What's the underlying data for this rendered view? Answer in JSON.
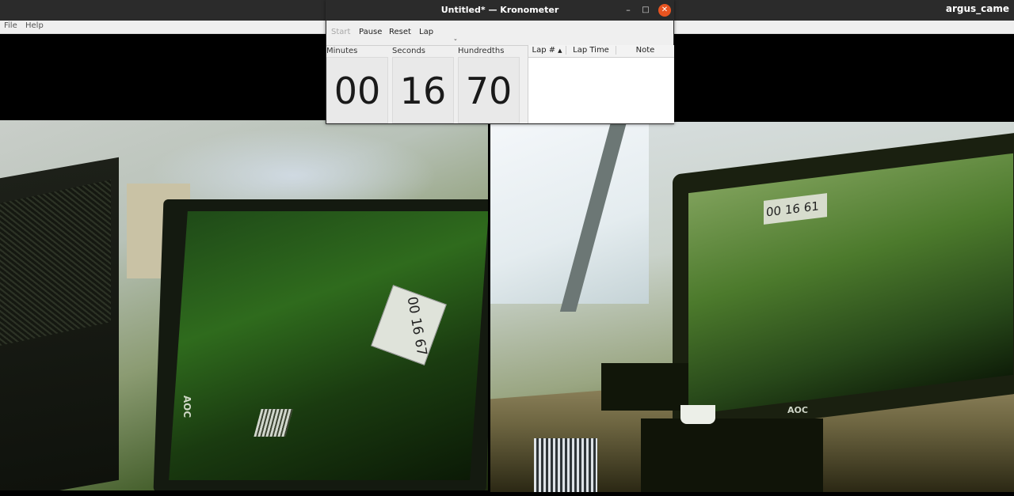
{
  "viewer": {
    "title": "argus_came",
    "menu": [
      "File",
      "Help"
    ]
  },
  "camera_left": {
    "screen_readout": "00 16 67",
    "monitor_logo": "AOC"
  },
  "camera_right": {
    "screen_readout": "00 16 61",
    "monitor_logo": "AOC"
  },
  "kronometer": {
    "title": "Untitled* — Kronometer",
    "window_buttons": {
      "minimize": "–",
      "maximize": "□",
      "close": "✕"
    },
    "toolbar": {
      "start": "Start",
      "pause": "Pause",
      "reset": "Reset",
      "lap": "Lap",
      "overflow": "⌄"
    },
    "labels": {
      "minutes": "Minutes",
      "seconds": "Seconds",
      "hundredths": "Hundredths"
    },
    "time": {
      "minutes": "00",
      "seconds": "16",
      "hundredths": "70"
    },
    "lap_table": {
      "columns": [
        "Lap #",
        "Lap Time",
        "Note"
      ],
      "sort_indicator": "▲",
      "rows": []
    }
  },
  "colors": {
    "titlebar": "#2b2b2b",
    "close_button": "#e95420",
    "window_bg": "#efefef"
  }
}
